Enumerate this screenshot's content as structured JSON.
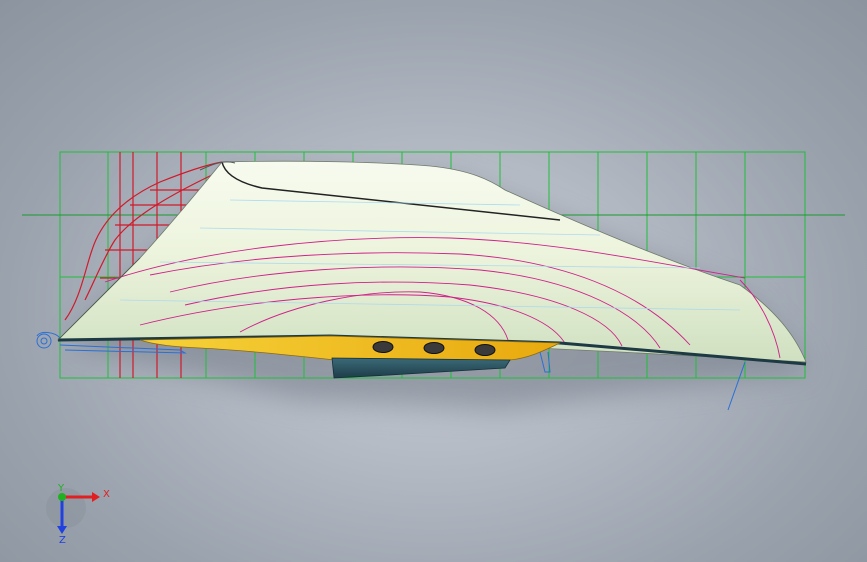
{
  "viewport": {
    "background": "#b4bac4",
    "model": {
      "hull_color": "#eef4e2",
      "keel_color": "#f4c21c",
      "grid_color": "#1fbf3a",
      "station_color": "#d01a2a",
      "waterline_color": "#d0208a",
      "sketch_color": "#2a6fd6"
    },
    "triad": {
      "x_label": "X",
      "y_label": "Y",
      "z_label": "Z",
      "x_color": "#e02020",
      "y_color": "#20b020",
      "z_color": "#2040e0"
    }
  }
}
